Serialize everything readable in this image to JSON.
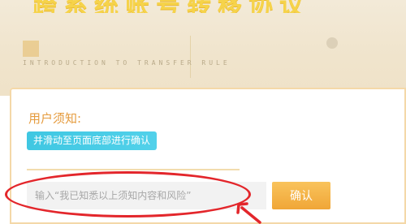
{
  "header": {
    "title": "跨系统账号转移协议",
    "subtitle": "INTRODUCTION TO TRANSFER RULE"
  },
  "notice": {
    "label": "用户须知:",
    "scroll_hint": "并滑动至页面底部进行确认"
  },
  "confirm": {
    "placeholder": "输入“我已知悉以上须知内容和风险”",
    "button_label": "确认"
  },
  "colors": {
    "accent": "#f0a637",
    "hint_bg": "#3fc7e2",
    "annotation": "#e3262b"
  }
}
